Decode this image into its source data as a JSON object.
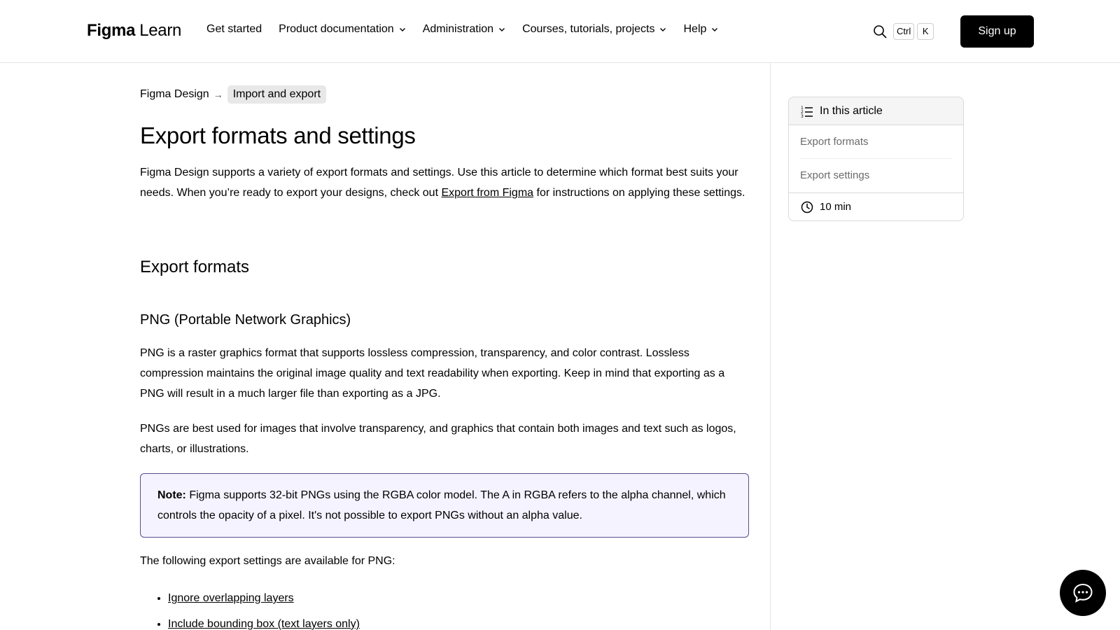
{
  "header": {
    "logo_brand": "Figma",
    "logo_suffix": "Learn",
    "nav": [
      {
        "label": "Get started",
        "has_menu": false
      },
      {
        "label": "Product documentation",
        "has_menu": true
      },
      {
        "label": "Administration",
        "has_menu": true
      },
      {
        "label": "Courses, tutorials, projects",
        "has_menu": true
      },
      {
        "label": "Help",
        "has_menu": true
      }
    ],
    "search_shortcut": [
      "Ctrl",
      "K"
    ],
    "signup_label": "Sign up"
  },
  "breadcrumb": {
    "parent": "Figma Design",
    "separator": "→",
    "current": "Import and export"
  },
  "article": {
    "title": "Export formats and settings",
    "intro_before_link": "Figma Design supports a variety of export formats and settings. Use this article to determine which format best suits your needs. When you’re ready to export your designs, check out ",
    "intro_link": "Export from Figma",
    "intro_after_link": " for instructions on applying these settings.",
    "section_heading": "Export formats",
    "subsection_heading": "PNG (Portable Network Graphics)",
    "paragraph_1": "PNG is a raster graphics format that supports lossless compression, transparency, and color contrast. Lossless compression maintains the original image quality and text readability when exporting. Keep in mind that exporting as a PNG will result in a much larger file than exporting as a JPG.",
    "paragraph_2": "PNGs are best used for images that involve transparency, and graphics that contain both images and text such as logos, charts, or illustrations.",
    "note_label": "Note:",
    "note_text": " Figma supports 32-bit PNGs using the RGBA color model. The A in RGBA refers to the alpha channel, which controls the opacity of a pixel. It's not possible to export PNGs without an alpha value.",
    "paragraph_3": "The following export settings are available for PNG:",
    "settings_links": [
      "Ignore overlapping layers",
      "Include bounding box (text layers only)"
    ]
  },
  "toc": {
    "heading": "In this article",
    "items": [
      "Export formats",
      "Export settings"
    ],
    "read_time": "10 min"
  },
  "colors": {
    "note_background": "#f5f3ff",
    "note_border": "#5a4e8c",
    "button_background": "#000000"
  },
  "icons": {
    "search": "search-icon",
    "toc": "list-icon",
    "time": "clock-icon",
    "chat": "chat-bubble-icon",
    "dropdown": "chevron-down-icon"
  }
}
